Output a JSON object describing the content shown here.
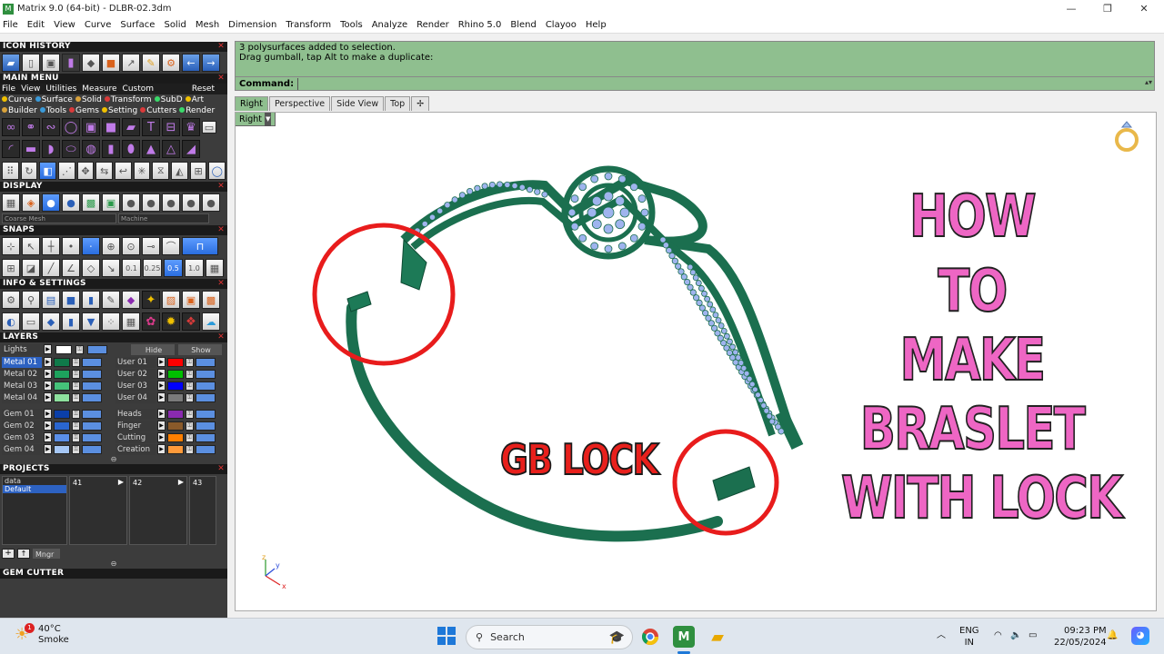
{
  "window": {
    "title": "Matrix 9.0 (64-bit) - DLBR-02.3dm",
    "app_icon": "M"
  },
  "menubar": [
    "File",
    "Edit",
    "View",
    "Curve",
    "Surface",
    "Solid",
    "Mesh",
    "Dimension",
    "Transform",
    "Tools",
    "Analyze",
    "Render",
    "Rhino 5.0",
    "Blend",
    "Clayoo",
    "Help"
  ],
  "panels": {
    "icon_history": "ICON HISTORY",
    "main_menu": "MAIN MENU",
    "display": "DISPLAY",
    "snaps": "SNAPS",
    "info_settings": "INFO & SETTINGS",
    "layers": "LAYERS",
    "projects": "PROJECTS",
    "gem_cutter": "GEM CUTTER"
  },
  "main_menu": {
    "tabs": [
      "File",
      "View",
      "Utilities",
      "Measure",
      "Custom"
    ],
    "reset": "Reset",
    "row1": [
      {
        "label": "Curve",
        "color": "#f0c000"
      },
      {
        "label": "Surface",
        "color": "#3a9ad9"
      },
      {
        "label": "Solid",
        "color": "#d9a23a"
      },
      {
        "label": "Transform",
        "color": "#d93a3a"
      },
      {
        "label": "SubD",
        "color": "#3ad96a"
      },
      {
        "label": "Art",
        "color": "#f0c000"
      }
    ],
    "row2": [
      {
        "label": "Builder",
        "color": "#d9a23a"
      },
      {
        "label": "Tools",
        "color": "#3a9ad9"
      },
      {
        "label": "Gems",
        "color": "#d93a3a"
      },
      {
        "label": "Setting",
        "color": "#f0c000"
      },
      {
        "label": "Cutters",
        "color": "#d93a3a"
      },
      {
        "label": "Render",
        "color": "#3ad96a"
      }
    ]
  },
  "display": {
    "mesh_quality": "Coarse Mesh",
    "machine": "Machine"
  },
  "snaps": {
    "values": [
      "0.1",
      "0.25",
      "0.5",
      "1.0"
    ]
  },
  "layers": {
    "lights_label": "Lights",
    "hide_label": "Hide",
    "show_label": "Show",
    "left": [
      {
        "name": "Metal 01",
        "color": "#0f7a4a",
        "selected": true
      },
      {
        "name": "Metal 02",
        "color": "#1da25d"
      },
      {
        "name": "Metal 03",
        "color": "#45c27a"
      },
      {
        "name": "Metal 04",
        "color": "#8de09d"
      },
      {
        "name": "Gem 01",
        "color": "#0b3fa8"
      },
      {
        "name": "Gem 02",
        "color": "#2a66d0"
      },
      {
        "name": "Gem 03",
        "color": "#5a8fe8"
      },
      {
        "name": "Gem 04",
        "color": "#a6c7f5"
      }
    ],
    "right": [
      {
        "name": "User 01",
        "color": "#ff0000"
      },
      {
        "name": "User 02",
        "color": "#00c000"
      },
      {
        "name": "User 03",
        "color": "#0000ff"
      },
      {
        "name": "User 04",
        "color": "#7a7a7a"
      },
      {
        "name": "Heads",
        "color": "#8a2ab0"
      },
      {
        "name": "Finger",
        "color": "#8a5a2a"
      },
      {
        "name": "Cutting",
        "color": "#ff7f00"
      },
      {
        "name": "Creation",
        "color": "#ff9a3a"
      }
    ]
  },
  "projects": {
    "list": [
      "data",
      "Default"
    ],
    "slots": [
      "41",
      "42",
      "43"
    ],
    "manager": "Mngr"
  },
  "command": {
    "history": [
      "3 polysurfaces added to selection.",
      "Drag gumball, tap Alt to make a duplicate:"
    ],
    "prompt": "Command:"
  },
  "viewport_tabs": [
    "Right",
    "Perspective",
    "Side View",
    "Top"
  ],
  "active_tab": "Right",
  "viewport_label": "Right",
  "overlay": {
    "title_lines": [
      "HOW",
      "TO",
      "MAKE",
      "BRASLET",
      "WITH LOCK"
    ],
    "callout": "GB LOCK",
    "title_color": "#ee66c4",
    "callout_color": "#e8201c",
    "circle_color": "#e81c1c"
  },
  "model": {
    "metal_color": "#1b6f4f",
    "gem_color": "#9fb4ee"
  },
  "axis": {
    "y": "y",
    "z": "z",
    "x": "x"
  },
  "taskbar": {
    "weather_temp": "40°C",
    "weather_desc": "Smoke",
    "weather_badge": "1",
    "search_label": "Search",
    "lang_top": "ENG",
    "lang_bottom": "IN",
    "time": "09:23 PM",
    "date": "22/05/2024"
  }
}
